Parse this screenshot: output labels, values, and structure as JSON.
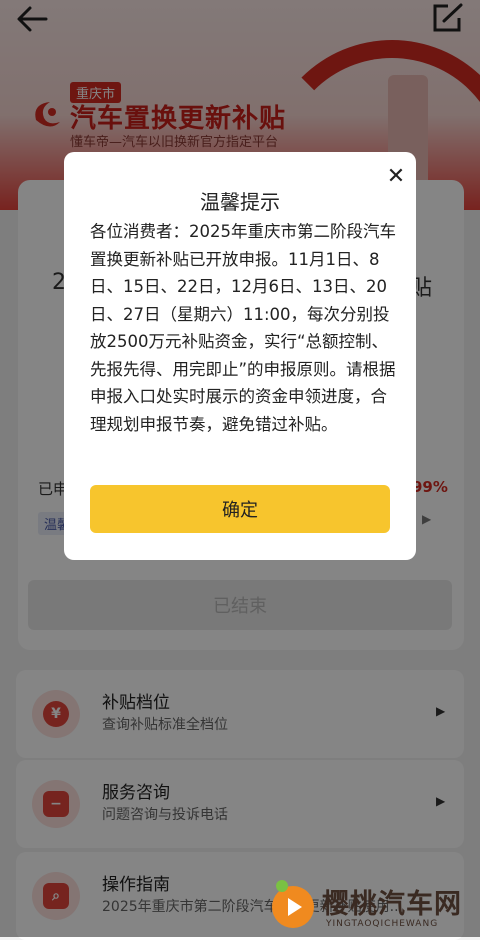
{
  "hero": {
    "city_tag": "重庆市",
    "title": "汽车置换更新补贴",
    "subtitle": "懂车帝—汽车以旧换新官方指定平台"
  },
  "card": {
    "big_left": "2",
    "big_right": "贴",
    "applied_label": "已申",
    "percent": "99%",
    "tag": "温馨",
    "ended_button": "已结束"
  },
  "list": [
    {
      "title": "补贴档位",
      "subtitle": "查询补贴标准全档位",
      "icon": "yen-icon",
      "glyph": "¥"
    },
    {
      "title": "服务咨询",
      "subtitle": "问题咨询与投诉电话",
      "icon": "chat-icon",
      "glyph": "−"
    },
    {
      "title": "操作指南",
      "subtitle": "2025年重庆市第二阶段汽车置换更新补贴使用...",
      "icon": "search-icon",
      "glyph": "⌕"
    }
  ],
  "dialog": {
    "title": "温馨提示",
    "body": "各位消费者：2025年重庆市第二阶段汽车置换更新补贴已开放申报。11月1日、8日、15日、22日，12月6日、13日、20日、27日（星期六）11:00，每次分别投放2500万元补贴资金，实行“总额控制、先报先得、用完即止”的申报原则。请根据申报入口处实时展示的资金申领进度，合理规划申报节奏，避免错过补贴。",
    "confirm": "确定",
    "close_glyph": "✕"
  },
  "watermark": {
    "text": "樱桃汽车网",
    "sub": "YINGTAOQICHEWANG"
  },
  "colors": {
    "brand_red": "#d32b22",
    "confirm_yellow": "#f7c52d"
  }
}
